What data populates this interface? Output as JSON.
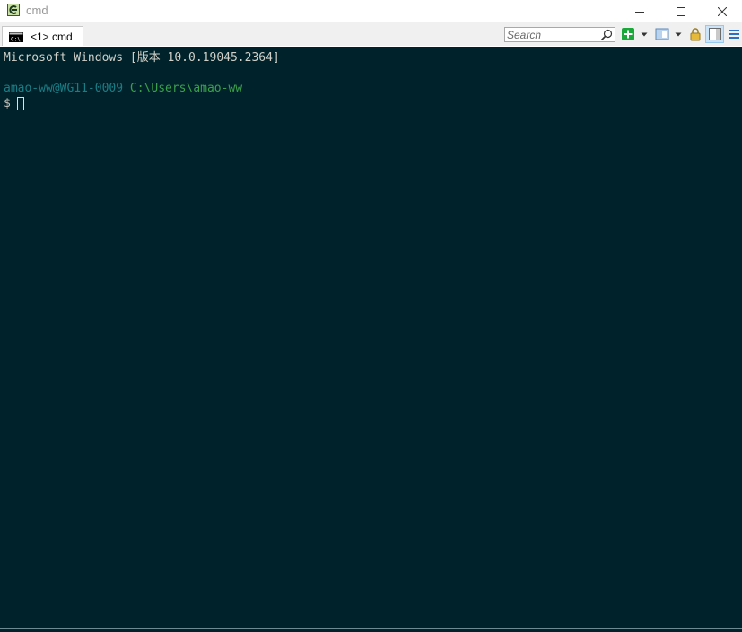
{
  "window": {
    "title": "cmd",
    "icon": "conemu-app-icon",
    "controls": [
      "minimize-icon",
      "maximize-icon",
      "close-icon"
    ]
  },
  "tabs": [
    {
      "label": "<1> cmd",
      "icon": "cmd-console-icon",
      "active": true
    }
  ],
  "toolbar": {
    "search_placeholder": "Search",
    "buttons": [
      "search-icon",
      "new-console-icon",
      "new-console-dropdown-icon",
      "split-pane-icon",
      "split-pane-dropdown-icon",
      "lock-icon",
      "toggle-panel-icon",
      "menu-icon"
    ]
  },
  "terminal": {
    "version_line": "Microsoft Windows [版本 10.0.19045.2364]",
    "prompt_user": "amao-ww@WG11-0009",
    "prompt_path": "C:\\Users\\amao-ww",
    "prompt_symbol": "$",
    "colors": {
      "background": "#00232b",
      "text": "#d0d0c8",
      "user": "#1a7d86",
      "path": "#3aa04a"
    }
  }
}
